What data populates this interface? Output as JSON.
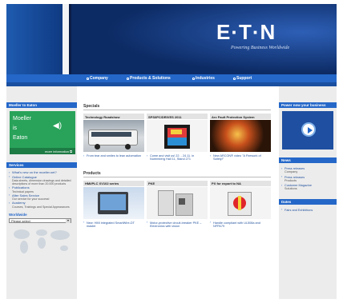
{
  "header": {
    "logo_text": "E·T·N",
    "tagline": "Powering Business Worldwide"
  },
  "nav": {
    "items": [
      {
        "label": "Company"
      },
      {
        "label": "Products & Solutions"
      },
      {
        "label": "Industries"
      },
      {
        "label": "Support"
      }
    ]
  },
  "left": {
    "moeller_title": "Moeller to Eaton",
    "moeller_lines": [
      "Moeller",
      "is",
      "Eaton"
    ],
    "more_info": "more information",
    "services_title": "Services",
    "services": [
      {
        "label": "What's new on the moeller.net?",
        "sub": ""
      },
      {
        "label": "Online Catalogue",
        "sub": "Data sheets, dimension drawings and detailed descriptions of more than 20.000 products"
      },
      {
        "label": "Publications",
        "sub": "Technical papers"
      },
      {
        "label": "After Sales Service",
        "sub": "Our service for your success!"
      },
      {
        "label": "Academy",
        "sub": "Courses, Trainings and Special Appearances"
      }
    ],
    "worldwide_title": "Worldwide",
    "worldwide_select": "Please select"
  },
  "center": {
    "specials_title": "Specials",
    "specials": [
      {
        "title": "Technology Roadshow",
        "link": "From tear and smiles to lean automation"
      },
      {
        "title": "SPS/IPC/DRIVES 2011",
        "link": "Come and visit us! 22. - 24.11. in Nuremberg Hall 11, Stand 271"
      },
      {
        "title": "Arc Fault Protection System",
        "link": "New ARCON® video \"A Firework of Safety!\""
      }
    ],
    "products_title": "Products",
    "products": [
      {
        "title": "HMI/PLC XV102 series",
        "link": "New: HMI integrated SmartWire-DT master"
      },
      {
        "title": "PKE",
        "link": "Motor-protective circuit-breaker PKE – Electronics with vision"
      },
      {
        "title": "PX for export to NA",
        "link": "Handle compliant with UL508a and NFPA79"
      }
    ]
  },
  "right": {
    "power_title": "Power now your business",
    "news_title": "News",
    "news": [
      {
        "label": "Press releases",
        "sub": "Company"
      },
      {
        "label": "Press releases",
        "sub": "Products"
      },
      {
        "label": "Customer Magazine",
        "sub": "Solutions"
      }
    ],
    "dates_title": "Dates",
    "dates": [
      {
        "label": "Fairs and Exhibitions"
      }
    ]
  },
  "colors": {
    "brand_blue": "#2467c8",
    "header_navy": "#0c2a63",
    "moeller_green": "#29a35a"
  }
}
